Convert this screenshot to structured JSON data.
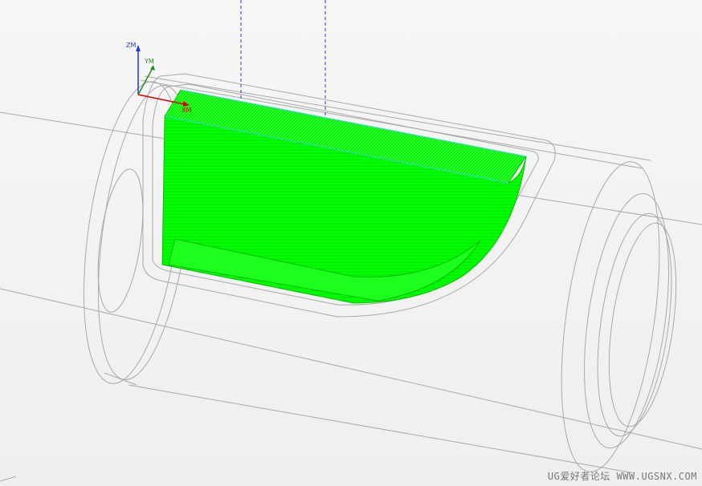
{
  "axes": {
    "z_label": "ZM",
    "y_label": "YM",
    "x_label": "XM"
  },
  "colors": {
    "toolpath": "#00ff00",
    "wire": "#a9a9a9",
    "axis_x": "#d40000",
    "axis_y": "#2a8a2a",
    "axis_z": "#1a3fd1",
    "tool_axis": "#2b3bd6",
    "background": "#f4f4f4"
  },
  "watermark": "UG爱好者论坛 WWW.UGSNX.COM"
}
